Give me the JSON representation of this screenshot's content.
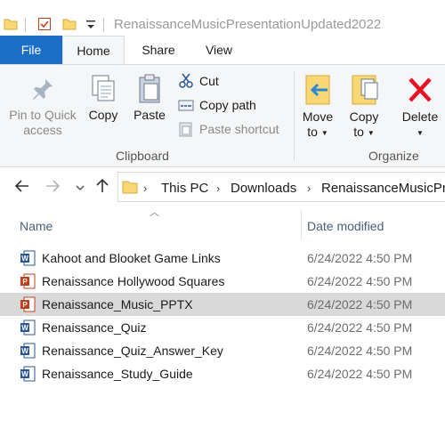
{
  "window": {
    "title": "RenaissanceMusicPresentationUpdated2022"
  },
  "tabs": {
    "file": "File",
    "home": "Home",
    "share": "Share",
    "view": "View"
  },
  "ribbon": {
    "clipboard": {
      "pin_line1": "Pin to Quick",
      "pin_line2": "access",
      "copy": "Copy",
      "paste": "Paste",
      "cut": "Cut",
      "copy_path": "Copy path",
      "paste_shortcut": "Paste shortcut",
      "group_label": "Clipboard"
    },
    "organize": {
      "move_line1": "Move",
      "move_line2": "to",
      "copy_line1": "Copy",
      "copy_line2": "to",
      "delete": "Delete",
      "group_label": "Organize"
    }
  },
  "address": {
    "crumbs": [
      "This PC",
      "Downloads",
      "RenaissanceMusicPre"
    ]
  },
  "columns": {
    "name": "Name",
    "date": "Date modified"
  },
  "files": [
    {
      "name": "Kahoot and Blooket Game Links",
      "date": "6/24/2022 4:50 PM",
      "type": "word"
    },
    {
      "name": "Renaissance Hollywood Squares",
      "date": "6/24/2022 4:50 PM",
      "type": "powerpoint"
    },
    {
      "name": "Renaissance_Music_PPTX",
      "date": "6/24/2022 4:50 PM",
      "type": "powerpoint"
    },
    {
      "name": "Renaissance_Quiz",
      "date": "6/24/2022 4:50 PM",
      "type": "word"
    },
    {
      "name": "Renaissance_Quiz_Answer_Key",
      "date": "6/24/2022 4:50 PM",
      "type": "word"
    },
    {
      "name": "Renaissance_Study_Guide",
      "date": "6/24/2022 4:50 PM",
      "type": "word"
    }
  ],
  "colors": {
    "file_tab": "#1a6fc4",
    "word": "#2b579a",
    "powerpoint": "#c43e1c",
    "folder": "#f8d775",
    "delete": "#e81123",
    "selected_row": "#d9d9d9"
  }
}
